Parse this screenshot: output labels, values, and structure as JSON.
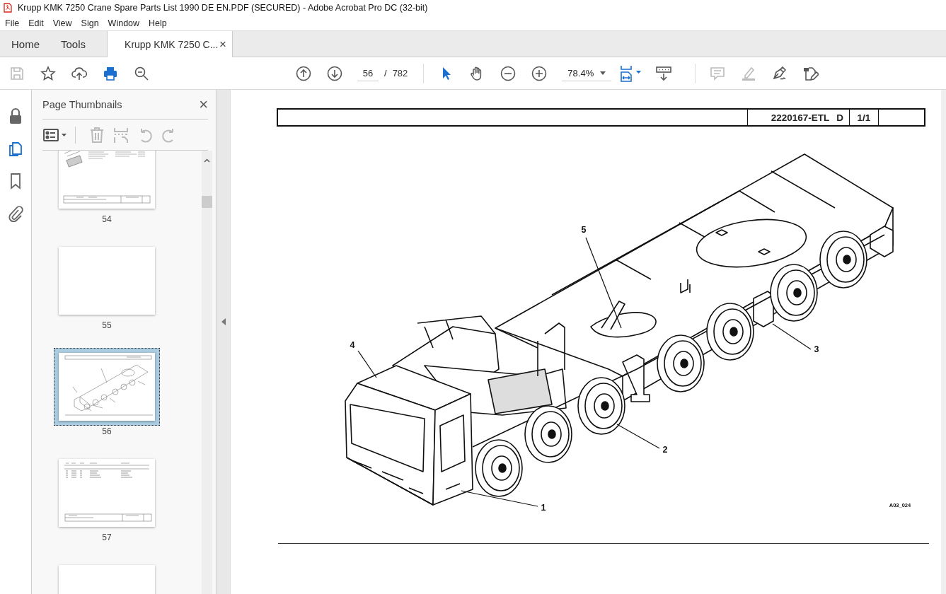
{
  "window": {
    "title": "Krupp KMK 7250 Crane Spare Parts List 1990 DE EN.PDF (SECURED) - Adobe Acrobat Pro DC (32-bit)"
  },
  "menu": [
    "File",
    "Edit",
    "View",
    "Sign",
    "Window",
    "Help"
  ],
  "tabs": [
    {
      "label": "Home",
      "selected": false
    },
    {
      "label": "Tools",
      "selected": false
    },
    {
      "label": "Krupp KMK 7250 C...",
      "selected": true,
      "close": "×"
    }
  ],
  "toolbar": {
    "left": [
      {
        "kind": "save",
        "disabled": true
      },
      {
        "kind": "star",
        "disabled": false
      },
      {
        "kind": "upload",
        "disabled": false
      },
      {
        "kind": "print",
        "disabled": false
      },
      {
        "kind": "search",
        "disabled": false
      }
    ],
    "page": "56",
    "separator": "/",
    "page_count": "782",
    "tools": [
      {
        "kind": "select",
        "selected": true
      },
      {
        "kind": "hand",
        "selected": false
      }
    ],
    "zoom": "78.4%",
    "right": [
      {
        "kind": "comment",
        "disabled": true
      },
      {
        "kind": "highlight",
        "disabled": true
      },
      {
        "kind": "sign",
        "disabled": false
      },
      {
        "kind": "edit",
        "disabled": false
      }
    ]
  },
  "sidebar": {
    "items": [
      {
        "kind": "lock",
        "selected": false
      },
      {
        "kind": "pages",
        "selected": true
      },
      {
        "kind": "bookmark",
        "selected": false
      },
      {
        "kind": "attachment",
        "selected": false
      }
    ]
  },
  "panel": {
    "title": "Page Thumbnails",
    "close": "×",
    "tools": [
      {
        "kind": "options",
        "disabled": false
      },
      {
        "kind": "delete",
        "disabled": true
      },
      {
        "kind": "extract",
        "disabled": true
      },
      {
        "kind": "rotate-left",
        "disabled": true
      },
      {
        "kind": "rotate-right",
        "disabled": true
      }
    ],
    "thumbnails": [
      {
        "page": "54",
        "kind": "list",
        "selected": false
      },
      {
        "page": "55",
        "kind": "blank",
        "selected": false
      },
      {
        "page": "56",
        "kind": "drawing",
        "selected": true
      },
      {
        "page": "57",
        "kind": "table",
        "selected": false
      },
      {
        "kind": "blank",
        "selected": false
      }
    ]
  },
  "document": {
    "header": {
      "drawing_no": "2220167-ETL",
      "revision": "D",
      "sheet": "1/1"
    },
    "callouts": [
      {
        "number": "5"
      },
      {
        "number": "4"
      },
      {
        "number": "3"
      },
      {
        "number": "2"
      },
      {
        "number": "1"
      }
    ],
    "figure_id": "A03_024"
  }
}
